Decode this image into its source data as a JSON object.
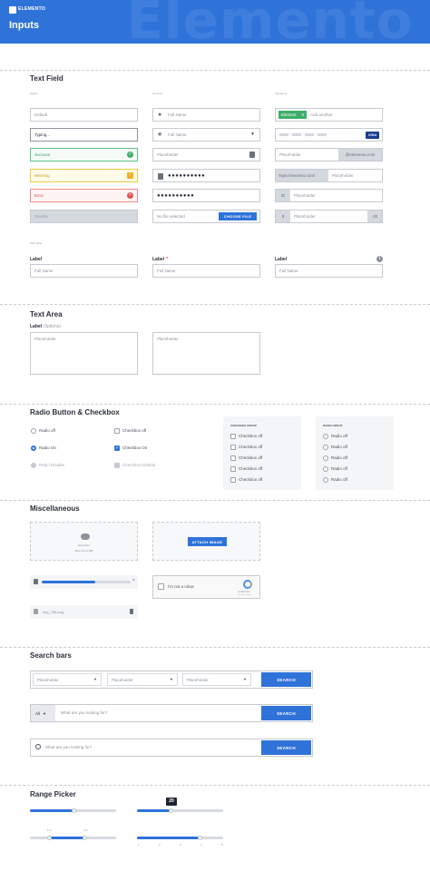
{
  "header": {
    "brand": "ELEMENTO",
    "title": "Inputs",
    "watermark": "Elemento"
  },
  "text_field": {
    "title": "Text Field",
    "col_states": "States",
    "col_icons": "Iconsets",
    "col_variations": "Variations",
    "states": [
      "Default",
      "Typing...",
      "Success",
      "Warning",
      "Error",
      "Disable"
    ],
    "icons": {
      "full_name_1": "Full Name",
      "full_name_2": "Full Name",
      "placeholder": "Placeholder",
      "password_1": "●●●●●●●●●●",
      "password_2": "●●●●●●●●●●",
      "no_file": "No file selected",
      "choose_file": "CHOOSE FILE"
    },
    "variations": {
      "tag": "Element",
      "add_another": "Add another",
      "card_number": "0000 - 0000 - 0000 - 0000",
      "card_brand": "VISA",
      "placeholder_1": "Placeholder",
      "domain_suffix": "@elemento.com",
      "url_prefix": "https://elemento.com/",
      "placeholder_2": "Placeholder",
      "id_prefix": "ID",
      "placeholder_3": "Placeholder",
      "dollar_prefix": "$",
      "placeholder_4": "Placeholder",
      "suffix_00": ".00"
    },
    "with_label": "With label",
    "labeled": [
      {
        "label": "Label",
        "placeholder": "Full Name"
      },
      {
        "label": "Label",
        "placeholder": "Full Name",
        "required": "*"
      },
      {
        "label": "Label",
        "placeholder": "Full Name",
        "info": "i"
      }
    ]
  },
  "text_area": {
    "title": "Text Area",
    "label": "Label",
    "optional": "Optional",
    "placeholder_1": "Placeholder",
    "placeholder_2": "Placeholder"
  },
  "radio_checkbox": {
    "title": "Radio Button & Checkbox",
    "radios": [
      "Radio off",
      "Radio On",
      "Radio Disable"
    ],
    "checkboxes": [
      "Checkbox off",
      "Checkbox On",
      "Checkbox Disable"
    ],
    "checkbox_group_title": "CHECKBOX GROUP",
    "checkbox_group": [
      "Checkbox off",
      "Checkbox off",
      "Checkbox off",
      "Checkbox off",
      "Checkbox off"
    ],
    "radio_group_title": "RADIO GROUP",
    "radio_group": [
      "Radio off",
      "Radio off",
      "Radio off",
      "Radio off",
      "Radio off"
    ]
  },
  "misc": {
    "title": "Miscellaneous",
    "drop_files": "Drop files",
    "max_size": "Max size 5 MB",
    "attach": "ATTACH IMAGE",
    "upload_progress": 0.6,
    "not_robot": "I'm not a robot",
    "recaptcha": "reCAPTCHA",
    "recaptcha_terms": "Privacy - Terms",
    "file_name": "img_756.png"
  },
  "search": {
    "title": "Search bars",
    "selects": [
      "Placeholder",
      "Placeholder",
      "Placeholder"
    ],
    "button": "SEARCH",
    "all_label": "All",
    "query_placeholder_1": "What are you looking for?",
    "query_placeholder_2": "What are you looking for?"
  },
  "range": {
    "title": "Range Picker",
    "single_value": 0.5,
    "tooltip": "20",
    "range_from_label": "1 m",
    "range_to_label": "3 m",
    "step_ticks": [
      "1",
      "2",
      "3",
      "4",
      "5"
    ]
  }
}
